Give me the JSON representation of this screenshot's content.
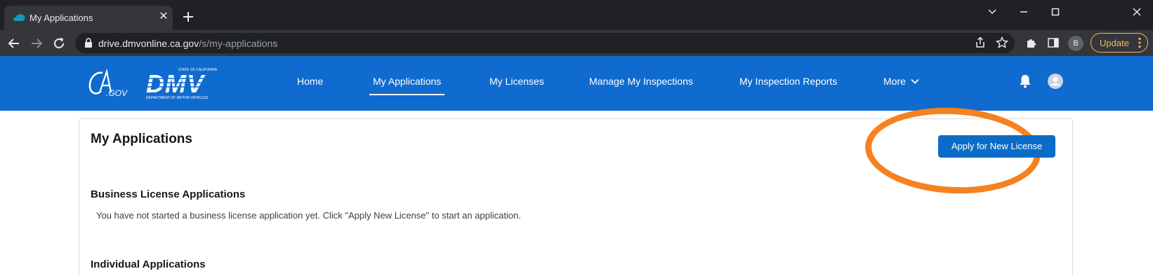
{
  "browser": {
    "tab": {
      "title": "My Applications"
    },
    "url": {
      "domain": "drive.dmvonline.ca.gov",
      "path": "/s/my-applications"
    },
    "profile_initial": "B",
    "update_label": "Update",
    "icons": [
      "salesforce-cloud-icon",
      "close-icon",
      "plus-icon",
      "chevron-down-icon",
      "minimize-icon",
      "maximize-icon",
      "close-window-icon",
      "back-arrow-icon",
      "forward-arrow-icon",
      "reload-icon",
      "lock-icon",
      "share-icon",
      "star-icon",
      "extensions-puzzle-icon",
      "side-panel-icon",
      "kebab-menu-icon"
    ]
  },
  "header": {
    "logo_ca": "CA.GOV",
    "logo_dmv_top": "STATE OF CALIFORNIA",
    "logo_dmv": "DMV",
    "logo_dmv_bottom": "DEPARTMENT OF MOTOR VEHICLES",
    "nav": [
      {
        "label": "Home"
      },
      {
        "label": "My Applications",
        "active": true
      },
      {
        "label": "My Licenses"
      },
      {
        "label": "Manage My Inspections"
      },
      {
        "label": "My Inspection Reports"
      },
      {
        "label": "More"
      }
    ],
    "colors": {
      "brand_blue": "#0f6bcf"
    }
  },
  "main": {
    "title": "My Applications",
    "apply_button": "Apply for New License",
    "highlight_color": "#f5821f",
    "sections": [
      {
        "title": "Business License Applications",
        "message": "You have not started a business license application yet. Click \"Apply New License\" to start an application."
      },
      {
        "title": "Individual Applications"
      }
    ]
  }
}
